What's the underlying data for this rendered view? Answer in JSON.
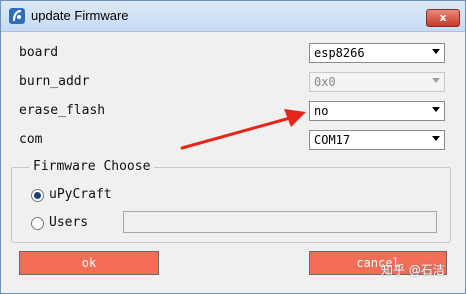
{
  "window": {
    "title": "update Firmware",
    "close_label": "x",
    "icon": "app-icon"
  },
  "form": {
    "board": {
      "label": "board",
      "value": "esp8266"
    },
    "burn_addr": {
      "label": "burn_addr",
      "value": "0x0"
    },
    "erase_flash": {
      "label": "erase_flash",
      "value": "no"
    },
    "com": {
      "label": "com",
      "value": "COM17"
    }
  },
  "firmware": {
    "group_title": "Firmware Choose",
    "option_upycraft": "uPyCraft",
    "option_users": "Users",
    "selected": "uPyCraft",
    "users_path": ""
  },
  "buttons": {
    "ok": "ok",
    "cancel": "cancel"
  },
  "watermark": "知乎 @石洁",
  "colors": {
    "button_bg": "#f36d57",
    "close_button": "#c5392a",
    "annotation_arrow": "#e8251a",
    "title_bar": "#c7dbf2"
  }
}
